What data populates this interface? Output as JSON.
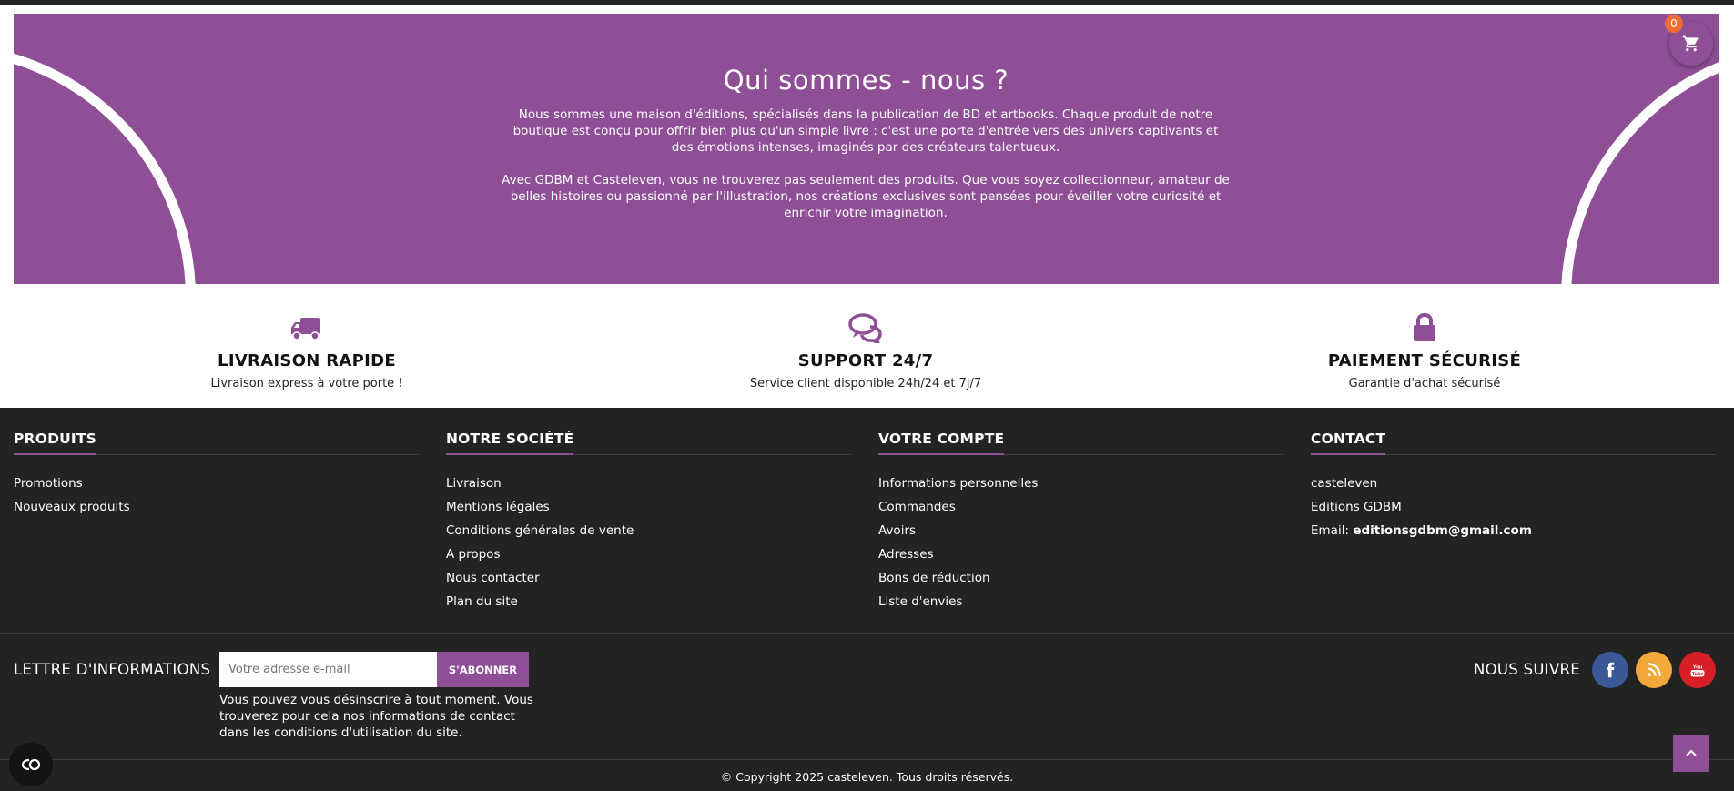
{
  "hero": {
    "title": "Qui sommes - nous ?",
    "paragraph1": "Nous sommes une maison d'éditions, spécialisés dans la publication de BD et artbooks. Chaque produit de notre boutique est conçu pour offrir bien plus qu'un simple livre : c'est une porte d'entrée vers des univers captivants et des émotions intenses, imaginés par des créateurs talentueux.",
    "paragraph2": "Avec GDBM et Casteleven, vous ne trouverez pas seulement des produits. Que vous soyez collectionneur, amateur de belles histoires ou passionné par l'illustration, nos créations exclusives sont pensées pour éveiller votre curiosité et enrichir votre imagination."
  },
  "cart": {
    "count": "0",
    "icon": "shopping-cart-icon"
  },
  "features": [
    {
      "icon": "truck-icon",
      "title": "LIVRAISON RAPIDE",
      "description": "Livraison express à votre porte !"
    },
    {
      "icon": "chat-bubbles-icon",
      "title": "SUPPORT 24/7",
      "description": "Service client disponible 24h/24 et 7j/7"
    },
    {
      "icon": "lock-icon",
      "title": "PAIEMENT SÉCURISÉ",
      "description": "Garantie d'achat sécurisé"
    }
  ],
  "footer": {
    "columns": [
      {
        "title": "PRODUITS",
        "links": [
          "Promotions",
          "Nouveaux produits"
        ]
      },
      {
        "title": "NOTRE SOCIÉTÉ",
        "links": [
          "Livraison",
          "Mentions légales",
          "Conditions générales de vente",
          "A propos",
          "Nous contacter",
          "Plan du site"
        ]
      },
      {
        "title": "VOTRE COMPTE",
        "links": [
          "Informations personnelles",
          "Commandes",
          "Avoirs",
          "Adresses",
          "Bons de réduction",
          "Liste d'envies"
        ]
      },
      {
        "title": "CONTACT",
        "lines": [
          "casteleven",
          "Editions GDBM"
        ],
        "email_label": "Email:",
        "email": "editionsgdbm@gmail.com"
      }
    ],
    "newsletter": {
      "label": "LETTRE D'INFORMATIONS",
      "placeholder": "Votre adresse e-mail",
      "button": "S'ABONNER",
      "note": "Vous pouvez vous désinscrire à tout moment. Vous trouverez pour cela nos informations de contact dans les conditions d'utilisation du site."
    },
    "follow": {
      "label": "NOUS SUIVRE",
      "networks": [
        "facebook-icon",
        "rss-icon",
        "youtube-icon"
      ]
    },
    "copyright": "© Copyright 2025 casteleven. Tous droits réservés."
  },
  "colors": {
    "accent": "#8e4f97",
    "footer_bg": "#232323",
    "badge": "#ef6c35",
    "facebook": "#3b5998",
    "rss": "#f3a93a",
    "youtube": "#d91f26"
  }
}
